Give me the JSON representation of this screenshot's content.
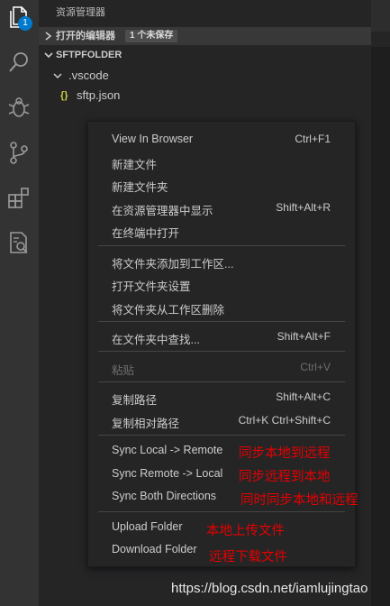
{
  "activity_bar": {
    "badge_count": "1",
    "icons": [
      "files-icon",
      "search-icon",
      "debug-icon",
      "source-control-icon",
      "extensions-icon",
      "remote-explorer-icon"
    ]
  },
  "sidebar": {
    "title": "资源管理器",
    "open_editors": {
      "label": "打开的编辑器",
      "dirty_badge": "1 个未保存"
    },
    "folder": {
      "label": "SFTPFOLDER"
    },
    "tree": [
      {
        "icon": "chevron-down-icon",
        "name": ".vscode"
      },
      {
        "icon": "json-file-icon",
        "glyph": "{}",
        "name": "sftp.json"
      }
    ]
  },
  "context_menu": {
    "items": [
      {
        "label": "View In Browser",
        "shortcut": "Ctrl+F1"
      },
      {
        "label": "新建文件",
        "shortcut": ""
      },
      {
        "label": "新建文件夹",
        "shortcut": ""
      },
      {
        "label": "在资源管理器中显示",
        "shortcut": "Shift+Alt+R"
      },
      {
        "label": "在终端中打开",
        "shortcut": ""
      },
      {
        "label": "将文件夹添加到工作区...",
        "shortcut": ""
      },
      {
        "label": "打开文件夹设置",
        "shortcut": ""
      },
      {
        "label": "将文件夹从工作区删除",
        "shortcut": ""
      },
      {
        "label": "在文件夹中查找...",
        "shortcut": "Shift+Alt+F"
      },
      {
        "label": "粘贴",
        "shortcut": "Ctrl+V",
        "disabled": true
      },
      {
        "label": "复制路径",
        "shortcut": "Shift+Alt+C"
      },
      {
        "label": "复制相对路径",
        "shortcut": "Ctrl+K Ctrl+Shift+C"
      },
      {
        "label": "Sync Local -> Remote",
        "shortcut": ""
      },
      {
        "label": "Sync Remote -> Local",
        "shortcut": ""
      },
      {
        "label": "Sync Both Directions",
        "shortcut": ""
      },
      {
        "label": "Upload Folder",
        "shortcut": ""
      },
      {
        "label": "Download Folder",
        "shortcut": ""
      }
    ]
  },
  "annotations": {
    "sync_local_remote": "同步本地到远程",
    "sync_remote_local": "同步远程到本地",
    "sync_both": "同时同步本地和远程",
    "upload": "本地上传文件",
    "download": "远程下载文件"
  },
  "watermark": "https://blog.csdn.net/iamlujingtao",
  "colors": {
    "accent": "#007acc",
    "annotation": "#e60000",
    "menu_bg": "#252526",
    "activity_bar": "#333333"
  }
}
